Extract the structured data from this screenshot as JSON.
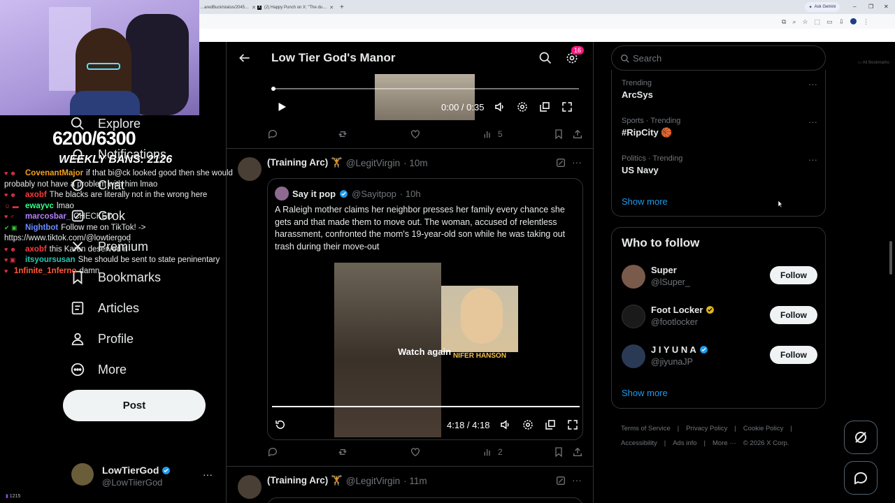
{
  "browser": {
    "tabs": [
      {
        "title": "…aredBuck/status/2045…"
      },
      {
        "title": "(2) Happy Punch on X: \"The du…"
      }
    ],
    "ask_gemini": "Ask Gemini",
    "all_bookmarks": "All Bookmarks"
  },
  "stream": {
    "counter": "6200/6300",
    "counter_label": "WEEKLY BANS: 2126",
    "viewers": "1215",
    "chat": [
      {
        "user": "CovenantMajor",
        "color": "#f4a020",
        "msg": "if that bi@ck looked good then she would probably not have a problem with him lmao"
      },
      {
        "user": "axobf",
        "color": "#ff3a3a",
        "msg": "The blacks are literally not in the wrong here"
      },
      {
        "user": "ewayvc",
        "color": "#33ff88",
        "msg": "lmao"
      },
      {
        "user": "marcosbar_",
        "color": "#b483ff",
        "msg": "CHECKED"
      },
      {
        "user": "Nightbot",
        "color": "#6a8dff",
        "msg": "Follow me on TikTok! -> https://www.tiktok.com/@lowtiergod"
      },
      {
        "user": "axobf",
        "color": "#ff3a3a",
        "msg": "this Karen deserved it"
      },
      {
        "user": "itsyoursusan",
        "color": "#26c7b0",
        "msg": "She should be sent to state peninentary"
      },
      {
        "user": "1nfinite_1nferno",
        "color": "#ff5a3a",
        "msg": "damn"
      }
    ]
  },
  "nav": {
    "items": [
      {
        "label": "Explore",
        "icon": "search-icon"
      },
      {
        "label": "Notifications",
        "icon": "bell-icon"
      },
      {
        "label": "Chat",
        "icon": "chat-icon"
      },
      {
        "label": "Grok",
        "icon": "grok-icon"
      },
      {
        "label": "Premium",
        "icon": "x-icon"
      },
      {
        "label": "Bookmarks",
        "icon": "bookmark-icon"
      },
      {
        "label": "Articles",
        "icon": "article-icon"
      },
      {
        "label": "Profile",
        "icon": "person-icon"
      },
      {
        "label": "More",
        "icon": "more-circle-icon"
      }
    ],
    "post_label": "Post",
    "account": {
      "name": "LowTierGod",
      "handle": "@LowTiierGod"
    }
  },
  "feed": {
    "title": "Low Tier God's Manor",
    "notif_count": "16",
    "video1": {
      "time": "0:00 / 0:35",
      "progress": 0.0
    },
    "tweet1_actions": {
      "views": "5"
    },
    "tweet2": {
      "name": "(Training Arc) 🏋",
      "handle": "@LegitVirgin",
      "time": "· 10m",
      "quote": {
        "name": "Say it pop",
        "handle": "@Sayitpop",
        "time": "· 10h",
        "text": "A Raleigh mother claims her neighbor presses her family every chance she gets and that made them to move out. The woman, accused of relentless harassment, confronted the mom's 19-year-old son while he was taking out trash during their move-out",
        "watch_again": "Watch again",
        "caption": "NIFER HANSON",
        "time_display": "4:18 / 4:18",
        "progress": 1.0
      },
      "views": "2"
    },
    "tweet3": {
      "name": "(Training Arc) 🏋",
      "handle": "@LegitVirgin",
      "time": "· 11m"
    }
  },
  "sidebar": {
    "search_placeholder": "Search",
    "trends": [
      {
        "category": "Trending",
        "topic": "ArcSys"
      },
      {
        "category": "Sports · Trending",
        "topic": "#RipCity 🏀"
      },
      {
        "category": "Politics · Trending",
        "topic": "US Navy"
      }
    ],
    "show_more": "Show more",
    "who_to_follow_title": "Who to follow",
    "follows": [
      {
        "name": "Super",
        "handle": "@lSuper_",
        "verified": false,
        "avatar_color": "#7a5a4a"
      },
      {
        "name": "Foot Locker",
        "handle": "@footlocker",
        "verified": true,
        "badge_color": "#e2b719",
        "avatar_color": "#1a1a1a"
      },
      {
        "name": "J I Y U N A",
        "handle": "@jiyunaJP",
        "verified": true,
        "badge_color": "#1d9bf0",
        "avatar_color": "#2a3a55"
      }
    ],
    "follow_label": "Follow",
    "footer": [
      "Terms of Service",
      "|",
      "Privacy Policy",
      "|",
      "Cookie Policy",
      "|",
      "Accessibility",
      "|",
      "Ads info",
      "|",
      "More ···",
      "© 2026 X Corp."
    ]
  },
  "colors": {
    "accent": "#1d9bf0",
    "bg": "#000000",
    "border": "#2f3336",
    "muted": "#71767b"
  }
}
